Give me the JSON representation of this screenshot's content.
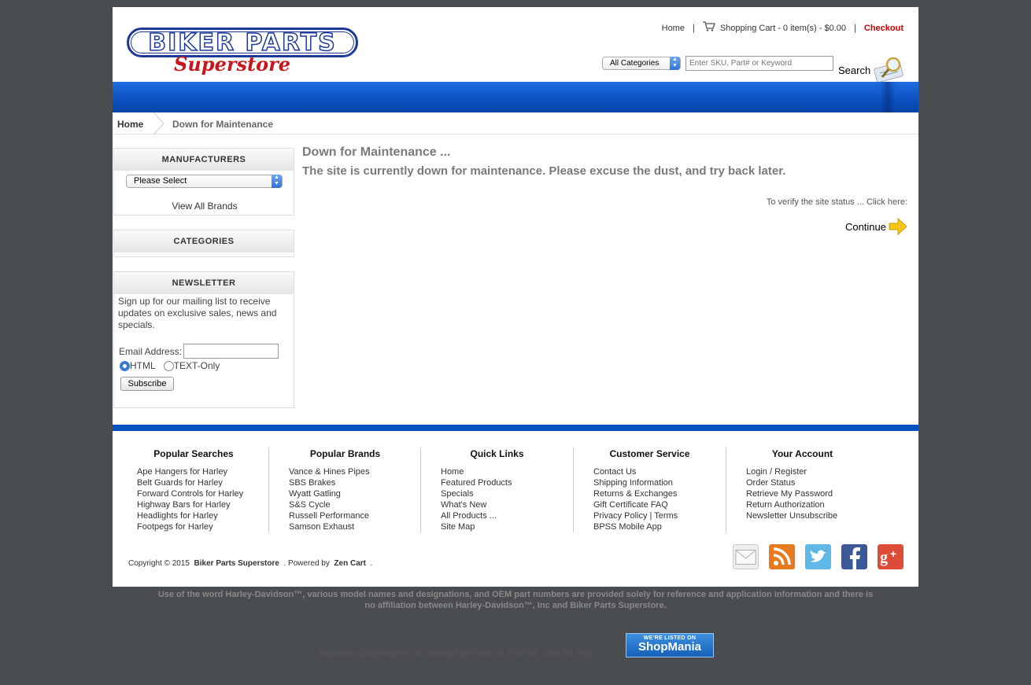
{
  "header": {
    "logo_main": "BIKER PARTS",
    "logo_sub": "Superstore",
    "home_link": "Home",
    "cart_text": "Shopping Cart - 0 item(s) - $0.00",
    "checkout_link": "Checkout",
    "category_select": "All Categories",
    "search_placeholder": "Enter SKU, Part# or Keyword",
    "search_button": "Search"
  },
  "breadcrumb": {
    "home": "Home",
    "current": "Down for Maintenance"
  },
  "sidebar": {
    "manufacturers": {
      "title": "MANUFACTURERS",
      "select_value": "Please Select",
      "view_all": "View All Brands"
    },
    "categories": {
      "title": "CATEGORIES"
    },
    "newsletter": {
      "title": "NEWSLETTER",
      "text": "Sign up for our mailing list to receive updates on exclusive sales, news and specials.",
      "email_label": "Email Address:",
      "radio_html": "HTML",
      "radio_text": "TEXT-Only",
      "subscribe": "Subscribe"
    }
  },
  "main": {
    "title": "Down for Maintenance ...",
    "message": "The site is currently down for maintenance. Please excuse the dust, and try back later.",
    "verify_text": "To verify the site status ... Click here:",
    "continue_label": "Continue"
  },
  "footer": {
    "columns": [
      {
        "title": "Popular Searches",
        "items": [
          "Ape Hangers for Harley",
          "Belt Guards for Harley",
          "Forward Controls for Harley",
          "Highway Bars for Harley",
          "Headlights for Harley",
          "Footpegs for Harley"
        ]
      },
      {
        "title": "Popular Brands",
        "items": [
          "Vance & Hines Pipes",
          "SBS Brakes",
          "Wyatt Gatling",
          "S&S Cycle",
          "Russell Performance",
          "Samson Exhaust"
        ]
      },
      {
        "title": "Quick Links",
        "items": [
          "Home",
          "Featured Products",
          "Specials",
          "What's New",
          "All Products ...",
          "Site Map"
        ]
      },
      {
        "title": "Customer Service",
        "items": [
          "Contact Us",
          "Shipping Information",
          "Returns & Exchanges",
          "Gift Certificate FAQ",
          "Privacy Policy | Terms",
          "BPSS Mobile App"
        ]
      },
      {
        "title": "Your Account",
        "items": [
          "Login / Register",
          "Order Status",
          "Retrieve My Password",
          "Return Authorization",
          "Newsletter Unsubscribe"
        ]
      }
    ],
    "copyright_prefix": "Copyright © 2015",
    "store_name": "Biker Parts Superstore",
    "powered_by": ". Powered by",
    "zen_cart": "Zen Cart",
    "copyright_end": ".",
    "social": [
      {
        "icon": "email-icon",
        "color": "#eeeeee"
      },
      {
        "icon": "rss-icon",
        "color": "#e8791e"
      },
      {
        "icon": "twitter-icon",
        "color": "#5fb8e6"
      },
      {
        "icon": "facebook-icon",
        "color": "#3b5998"
      },
      {
        "icon": "google-plus-icon",
        "color": "#dd4b39"
      }
    ]
  },
  "disclaimer": {
    "line1": "Use of the word Harley-Davidson™, various model names and designations, and OEM part numbers are provided solely for reference and application information and there is",
    "line2": "no affiliation between Harley-Davidson™, Inc and Biker Parts Superstore."
  },
  "thefind_text": "Bikerparts Superstore is an Upfront Merchant on TheFind. Click for info.",
  "shopmania": {
    "line1": "WE'RE LISTED ON",
    "line2": "ShopMania"
  }
}
